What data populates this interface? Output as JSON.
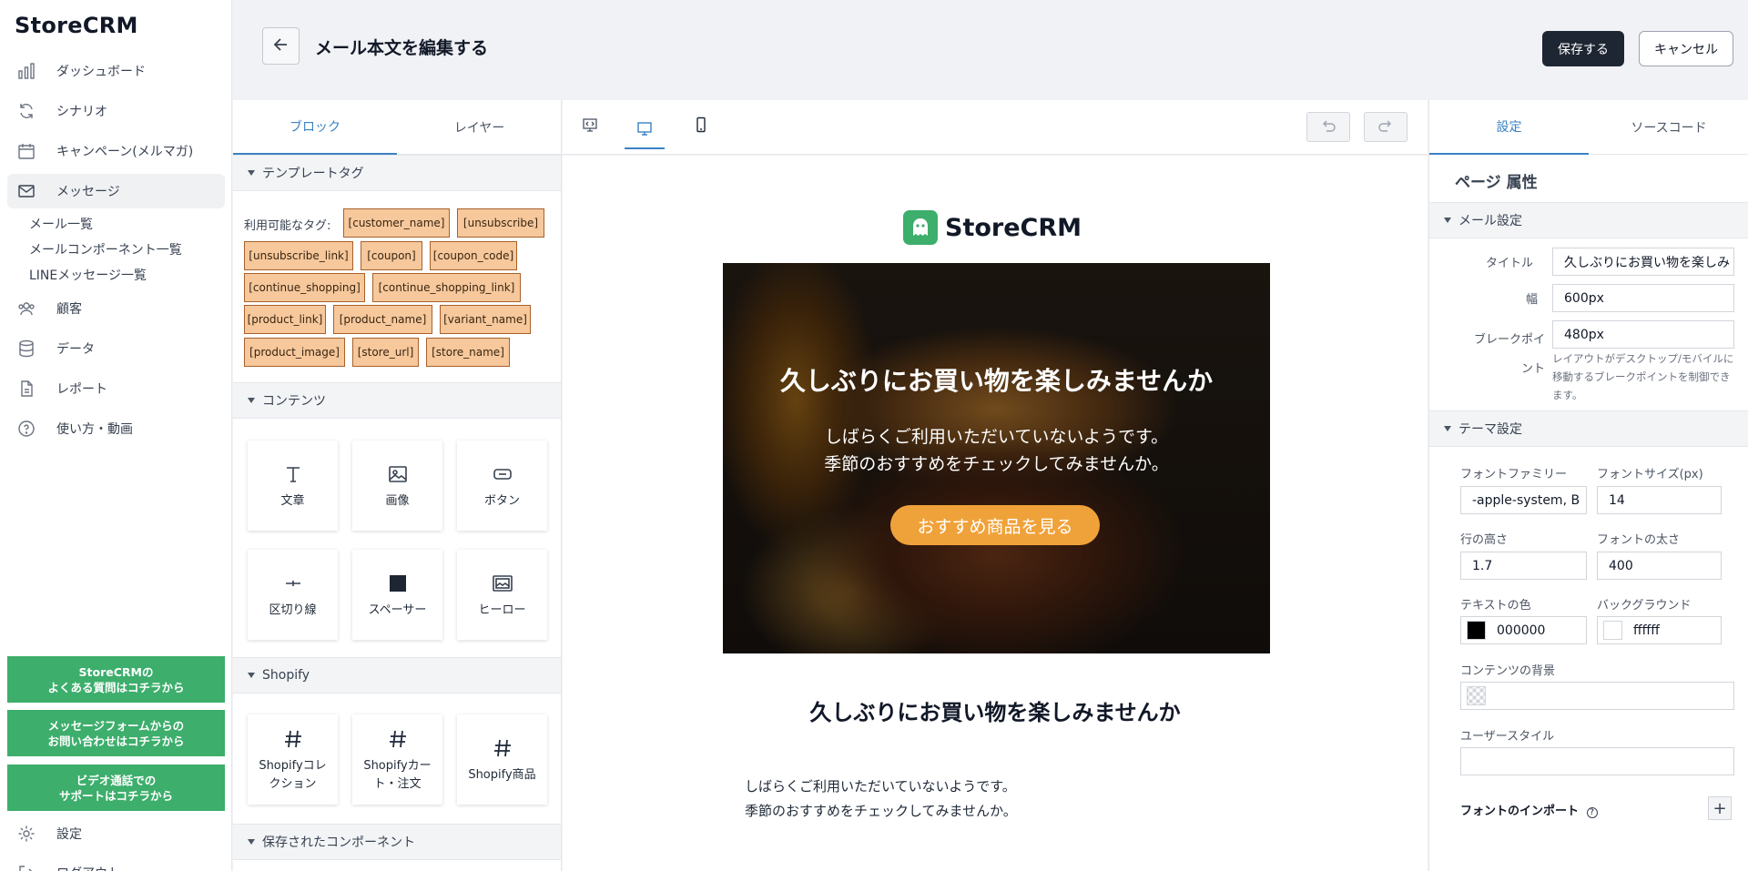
{
  "app": {
    "name": "StoreCRM"
  },
  "sidebar": {
    "items": [
      {
        "label": "ダッシュボード",
        "icon": "bar-chart-icon"
      },
      {
        "label": "シナリオ",
        "icon": "refresh-icon"
      },
      {
        "label": "キャンペーン(メルマガ)",
        "icon": "calendar-icon"
      },
      {
        "label": "メッセージ",
        "icon": "mail-icon"
      },
      {
        "label": "顧客",
        "icon": "users-icon"
      },
      {
        "label": "データ",
        "icon": "database-icon"
      },
      {
        "label": "レポート",
        "icon": "document-icon"
      },
      {
        "label": "使い方・動画",
        "icon": "help-icon"
      }
    ],
    "sub_items": [
      "メール一覧",
      "メールコンポーネント一覧",
      "LINEメッセージ一覧"
    ],
    "support_buttons": [
      "StoreCRMの\nよくある質問はコチラから",
      "メッセージフォームからの\nお問い合わせはコチラから",
      "ビデオ通話での\nサポートはコチラから"
    ],
    "settings_label": "設定",
    "partial_label": "ログアウト"
  },
  "header": {
    "title": "メール本文を編集する",
    "save_label": "保存する",
    "cancel_label": "キャンセル"
  },
  "left_panel": {
    "tabs": [
      "ブロック",
      "レイヤー"
    ],
    "template_tags_title": "テンプレートタグ",
    "available_tags_label": "利用可能なタグ:",
    "tags": [
      "[customer_name]",
      "[unsubscribe]",
      "[unsubscribe_link]",
      "[coupon]",
      "[coupon_code]",
      "[continue_shopping]",
      "[continue_shopping_link]",
      "[product_link]",
      "[product_name]",
      "[variant_name]",
      "[product_image]",
      "[store_url]",
      "[store_name]"
    ],
    "contents_title": "コンテンツ",
    "blocks": [
      {
        "label": "文章",
        "icon": "text-icon"
      },
      {
        "label": "画像",
        "icon": "image-icon"
      },
      {
        "label": "ボタン",
        "icon": "button-icon"
      },
      {
        "label": "区切り線",
        "icon": "divider-icon"
      },
      {
        "label": "スペーサー",
        "icon": "spacer-icon"
      },
      {
        "label": "ヒーロー",
        "icon": "hero-icon"
      }
    ],
    "shopify_title": "Shopify",
    "shopify_blocks": [
      {
        "label": "Shopifyコレクション",
        "icon": "hash-icon"
      },
      {
        "label": "Shopifyカート・注文",
        "icon": "hash-icon"
      },
      {
        "label": "Shopify商品",
        "icon": "hash-icon"
      }
    ],
    "saved_components_title": "保存されたコンポーネント"
  },
  "preview": {
    "logo_text": "StoreCRM",
    "hero_title": "久しぶりにお買い物を楽しみませんか",
    "hero_body": "しばらくご利用いただいていないようです。\n季節のおすすめをチェックしてみませんか。",
    "hero_cta": "おすすめ商品を見る",
    "heading": "久しぶりにお買い物を楽しみませんか",
    "paragraph": "しばらくご利用いただいていないようです。\n季節のおすすめをチェックしてみませんか。",
    "cta_color": "#f0a23a"
  },
  "right_panel": {
    "tabs": [
      "設定",
      "ソースコード"
    ],
    "title": "ページ 属性",
    "mail_settings_title": "メール設定",
    "fields": {
      "title_label": "タイトル",
      "title_value": "久しぶりにお買い物を楽しみ",
      "width_label": "幅",
      "width_value": "600px",
      "breakpoint_label": "ブレークポイント",
      "breakpoint_value": "480px",
      "breakpoint_help": "レイアウトがデスクトップ/モバイルに移動するブレークポイントを制御できます。"
    },
    "theme_title": "テーマ設定",
    "theme": {
      "font_family_label": "フォントファミリー",
      "font_family_value": "-apple-system, B",
      "font_size_label": "フォントサイズ(px)",
      "font_size_value": "14",
      "line_height_label": "行の高さ",
      "line_height_value": "1.7",
      "font_weight_label": "フォントの太さ",
      "font_weight_value": "400",
      "text_color_label": "テキストの色",
      "text_color_value": "000000",
      "background_label": "バックグラウンド",
      "background_value": "ffffff",
      "content_bg_label": "コンテンツの背景",
      "user_style_label": "ユーザースタイル",
      "font_import_label": "フォントのインポート"
    }
  }
}
